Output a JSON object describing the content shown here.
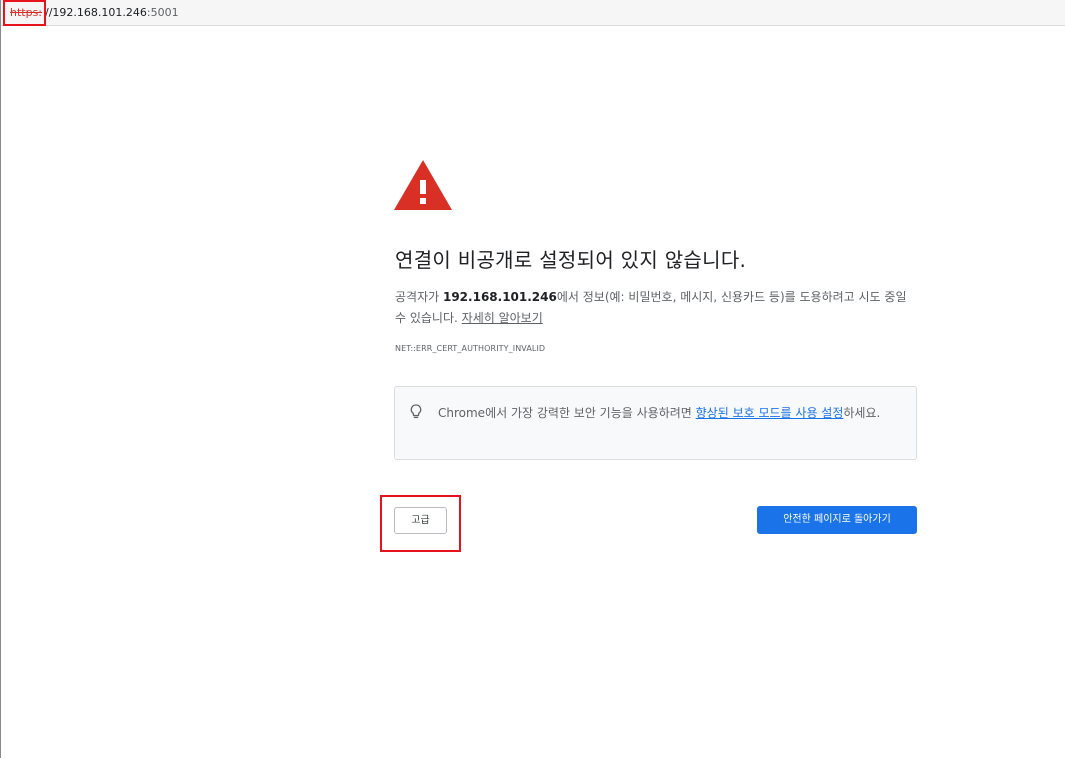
{
  "address_bar": {
    "scheme": "https:",
    "host": "//192.168.101.246",
    "port": ":5001"
  },
  "interstitial": {
    "heading": "연결이 비공개로 설정되어 있지 않습니다.",
    "explanation_before": "공격자가 ",
    "explanation_host": "192.168.101.246",
    "explanation_after": "에서 정보(예: 비밀번호, 메시지, 신용카드 등)를 도용하려고 시도 중일 수 있습니다. ",
    "learn_more_link": "자세히 알아보기",
    "error_code": "NET::ERR_CERT_AUTHORITY_INVALID",
    "tip_before": "Chrome에서 가장 강력한 보안 기능을 사용하려면 ",
    "tip_link": "향상된 보호 모드를 사용 설정",
    "tip_after": "하세요.",
    "advanced_button": "고급",
    "back_button": "안전한 페이지로 돌아가기"
  },
  "colors": {
    "warning_red": "#d93025",
    "primary_blue": "#1a73e8",
    "annotation_red": "#e8121d"
  },
  "icons": {
    "warning": "warning-triangle-icon",
    "tip": "lightbulb-icon"
  }
}
